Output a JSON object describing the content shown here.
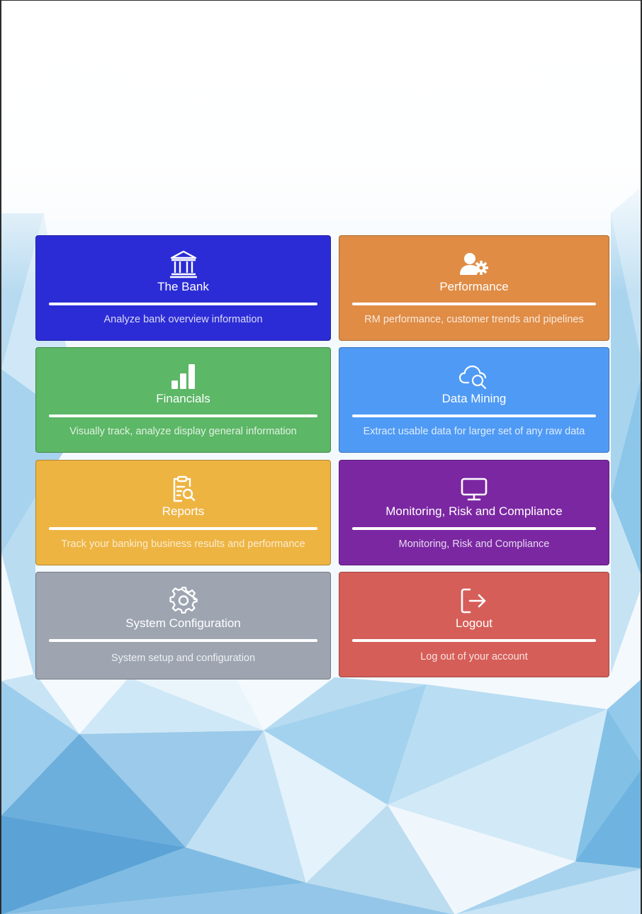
{
  "colors": {
    "the_bank": "#2c2cd6",
    "performance": "#e08c45",
    "financials": "#5cb766",
    "data_mining": "#4f9af5",
    "reports": "#eeb442",
    "monitoring": "#7b27a2",
    "system_configuration": "#9ea5b1",
    "logout": "#d65e58"
  },
  "tiles": [
    {
      "icon": "bank-icon",
      "title": "The Bank",
      "description": "Analyze bank overview information"
    },
    {
      "icon": "user-gear-icon",
      "title": "Performance",
      "description": "RM performance, customer trends and pipelines"
    },
    {
      "icon": "bar-chart-icon",
      "title": "Financials",
      "description": "Visually track, analyze display general information"
    },
    {
      "icon": "cloud-search-icon",
      "title": "Data Mining",
      "description": "Extract usable data for larger set of any raw data"
    },
    {
      "icon": "clipboard-search-icon",
      "title": "Reports",
      "description": "Track your banking business results and performance"
    },
    {
      "icon": "monitor-icon",
      "title": "Monitoring, Risk and Compliance",
      "description": "Monitoring, Risk and Compliance"
    },
    {
      "icon": "gear-icon",
      "title": "System Configuration",
      "description": "System setup and configuration"
    },
    {
      "icon": "logout-icon",
      "title": "Logout",
      "description": "Log out of your account"
    }
  ]
}
